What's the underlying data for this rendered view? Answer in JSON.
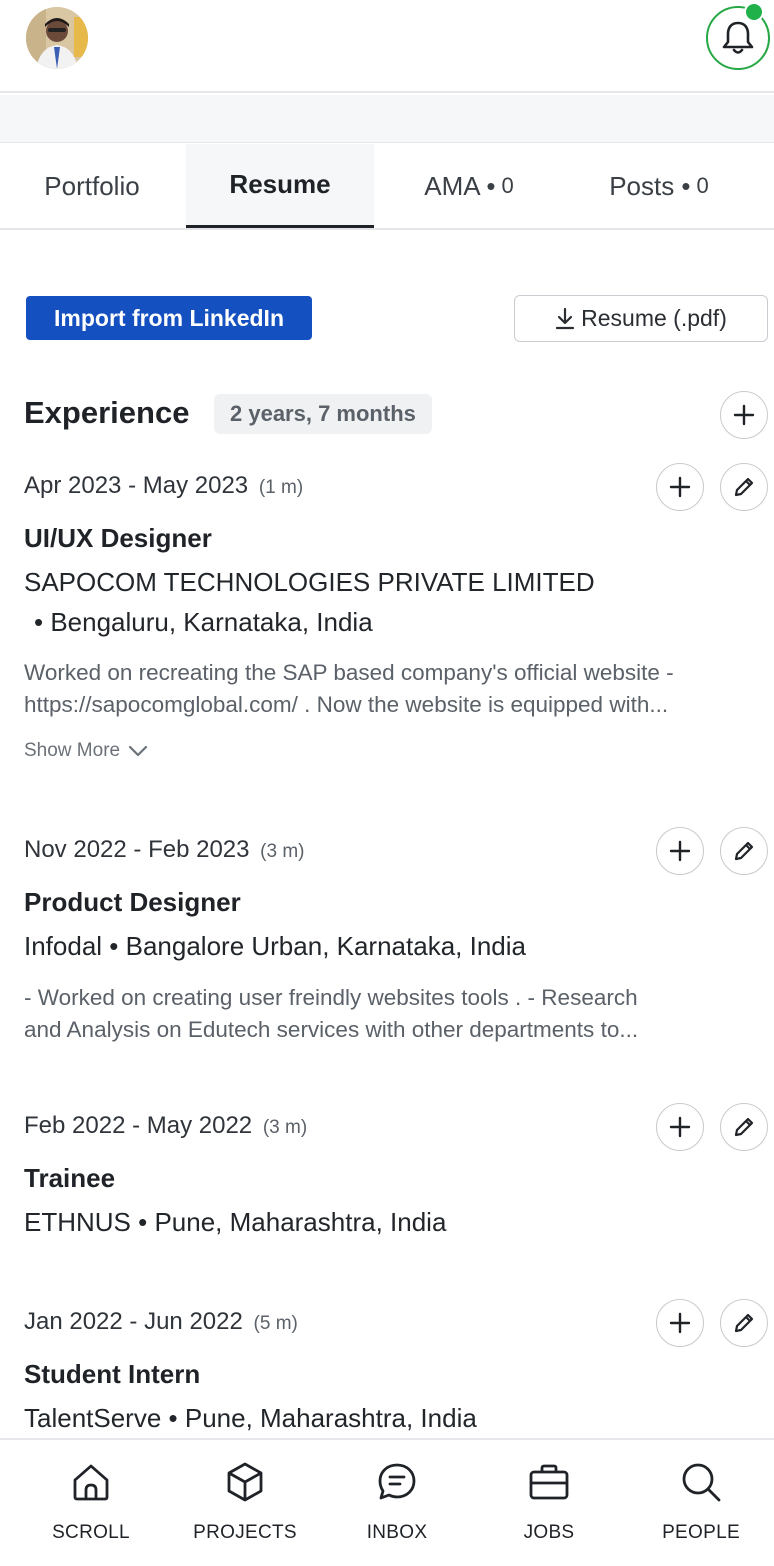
{
  "header": {
    "avatar_icon": "profile-avatar",
    "notification_icon": "bell-icon",
    "notification_status_color": "#20b14a"
  },
  "tabs": [
    {
      "label": "Portfolio",
      "count": ""
    },
    {
      "label": "Resume",
      "count": ""
    },
    {
      "label": "AMA •",
      "count": "0"
    },
    {
      "label": "Posts •",
      "count": "0"
    }
  ],
  "actions": {
    "import_label": "Import from LinkedIn",
    "resume_label": "Resume (.pdf)",
    "accent_color": "#1450c0"
  },
  "experience": {
    "title": "Experience",
    "total": "2 years, 7 months",
    "entries": [
      {
        "date": "Apr 2023 - May 2023",
        "duration": "(1 m)",
        "role": "UI/UX Designer",
        "company": "SAPOCOM TECHNOLOGIES PRIVATE LIMITED",
        "location": "• Bengaluru, Karnataka, India",
        "desc_line1": "Worked on recreating the SAP based company's official website -",
        "desc_line2": "https://sapocomglobal.com/ . Now the website is equipped with...",
        "show_more": "Show More"
      },
      {
        "date": "Nov 2022 - Feb 2023",
        "duration": "(3 m)",
        "role": "Product Designer",
        "company": "Infodal • Bangalore Urban, Karnataka, India",
        "desc_line1": "- Worked on creating user freindly websites tools . - Research",
        "desc_line2": "and Analysis on Edutech services with other departments to..."
      },
      {
        "date": "Feb 2022 - May 2022",
        "duration": "(3 m)",
        "role": "Trainee",
        "company": "ETHNUS • Pune, Maharashtra, India"
      },
      {
        "date": "Jan 2022 - Jun 2022",
        "duration": "(5 m)",
        "role": "Student Intern",
        "company": "TalentServe • Pune, Maharashtra, India"
      }
    ]
  },
  "nav": [
    {
      "label": "SCROLL",
      "icon": "home-icon"
    },
    {
      "label": "PROJECTS",
      "icon": "cube-icon"
    },
    {
      "label": "INBOX",
      "icon": "chat-icon"
    },
    {
      "label": "JOBS",
      "icon": "briefcase-icon"
    },
    {
      "label": "PEOPLE",
      "icon": "search-icon"
    }
  ]
}
